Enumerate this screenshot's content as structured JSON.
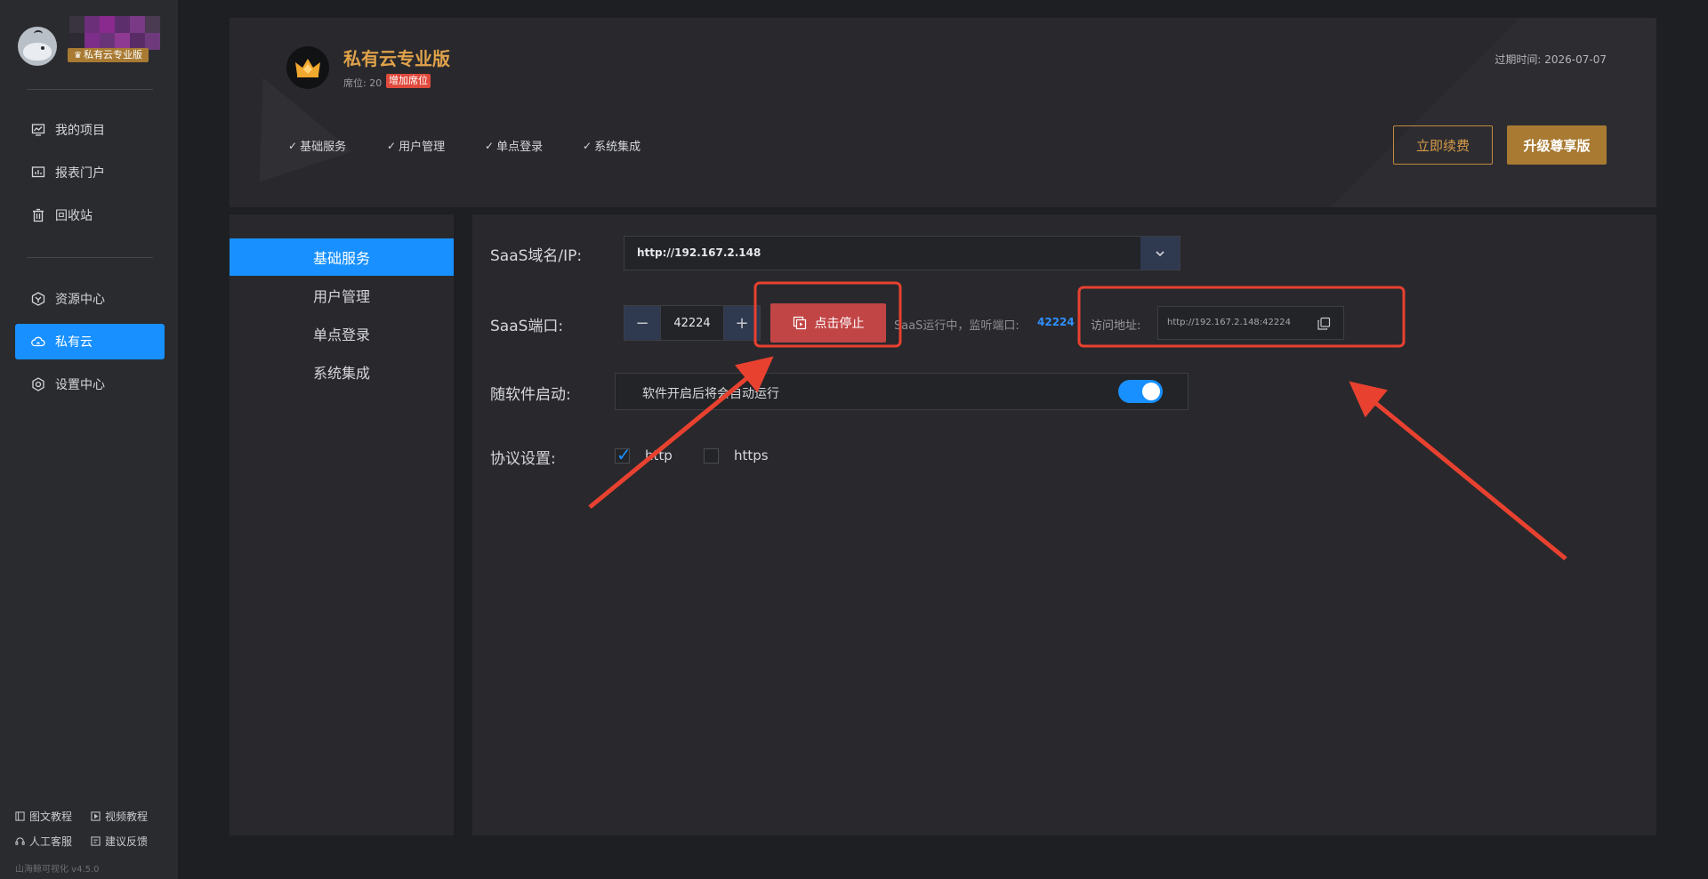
{
  "sidebar": {
    "badge": "私有云专业版",
    "nav_top": [
      {
        "label": "我的项目",
        "icon": "chart-monitor-icon"
      },
      {
        "label": "报表门户",
        "icon": "dashboard-icon"
      },
      {
        "label": "回收站",
        "icon": "trash-icon"
      }
    ],
    "nav_bottom": [
      {
        "label": "资源中心",
        "icon": "resource-hex-icon"
      },
      {
        "label": "私有云",
        "icon": "cloud-icon",
        "active": true
      },
      {
        "label": "设置中心",
        "icon": "settings-gear-icon"
      }
    ],
    "footer": {
      "docs": "图文教程",
      "videos": "视频教程",
      "support": "人工客服",
      "feedback": "建议反馈",
      "version": "山海鲸可视化 v4.5.0"
    }
  },
  "header": {
    "plan_title": "私有云专业版",
    "seats": "席位: 20",
    "add_seat": "增加席位",
    "expire": "过期时间:  2026-07-07",
    "features": [
      "基础服务",
      "用户管理",
      "单点登录",
      "系统集成"
    ],
    "renew_btn": "立即续费",
    "upgrade_btn": "升级尊享版"
  },
  "subnav": {
    "items": [
      {
        "label": "基础服务",
        "active": true
      },
      {
        "label": "用户管理"
      },
      {
        "label": "单点登录"
      },
      {
        "label": "系统集成"
      }
    ]
  },
  "form": {
    "domain_label": "SaaS域名/IP:",
    "domain_value": "http://192.167.2.148",
    "port_label": "SaaS端口:",
    "port_value": "42224",
    "stop_btn": "点击停止",
    "status_text": "SaaS运行中，监听端口:",
    "status_port": "42224",
    "addr_label": "访问地址:",
    "addr_value": "http://192.167.2.148:42224",
    "autostart_label": "随软件启动:",
    "autostart_text": "软件开启后将会自动运行",
    "autostart_on": true,
    "protocol_label": "协议设置:",
    "protocols": [
      {
        "label": "http",
        "checked": true
      },
      {
        "label": "https",
        "checked": false
      }
    ]
  },
  "colors": {
    "accent": "#1890ff",
    "gold": "#a87a32",
    "danger": "#c24546",
    "annotation": "#e8412f"
  }
}
